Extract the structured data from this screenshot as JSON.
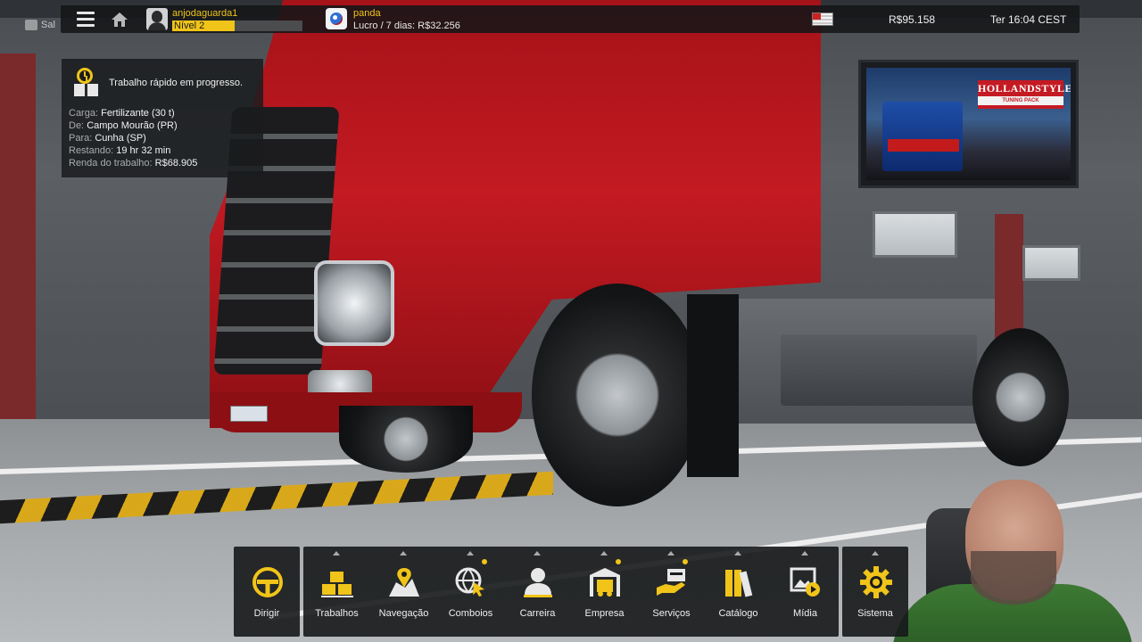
{
  "topbar": {
    "ghost_label": "Sal",
    "username": "anjodaguarda1",
    "level_label": "Nível 2",
    "level_progress": 0.48,
    "company_name": "panda",
    "company_profit": "Lucro / 7 dias: R$32.256",
    "money": "R$95.158",
    "clock": "Ter 16:04 CEST"
  },
  "job": {
    "title": "Trabalho rápido em progresso.",
    "rows": [
      {
        "label": "Carga:",
        "value": "Fertilizante (30 t)"
      },
      {
        "label": "De:",
        "value": "Campo Mourão (PR)"
      },
      {
        "label": "Para:",
        "value": "Cunha (SP)"
      },
      {
        "label": "Restando:",
        "value": "19 hr 32 min"
      },
      {
        "label": "Renda do trabalho:",
        "value": "R$68.905"
      }
    ]
  },
  "tv_ad": {
    "brand": "HOLLANDSTYLE",
    "sub": "TUNING PACK"
  },
  "dock": {
    "drive": {
      "label": "Dirigir",
      "icon": "steering-wheel-icon"
    },
    "items": [
      {
        "label": "Trabalhos",
        "icon": "cargo-boxes-icon",
        "notif": false
      },
      {
        "label": "Navegação",
        "icon": "map-pin-icon",
        "notif": false
      },
      {
        "label": "Comboios",
        "icon": "globe-cursor-icon",
        "notif": true
      },
      {
        "label": "Carreira",
        "icon": "person-icon",
        "notif": false
      },
      {
        "label": "Empresa",
        "icon": "garage-truck-icon",
        "notif": true
      },
      {
        "label": "Serviços",
        "icon": "service-hand-icon",
        "notif": true
      },
      {
        "label": "Catálogo",
        "icon": "books-icon",
        "notif": false
      },
      {
        "label": "Mídia",
        "icon": "media-play-icon",
        "notif": false
      }
    ],
    "system": {
      "label": "Sistema",
      "icon": "gear-icon"
    }
  },
  "colors": {
    "accent": "#f0c419",
    "panel_bg": "#16181a",
    "text": "#f0f0f0"
  }
}
